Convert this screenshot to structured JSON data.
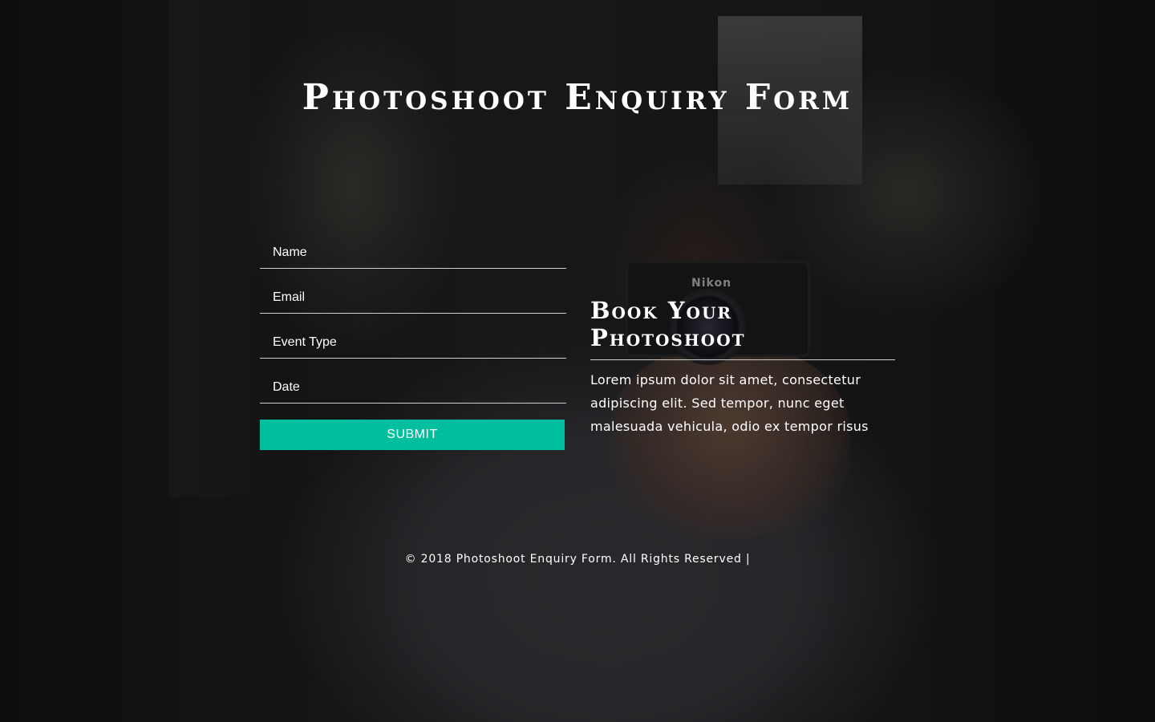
{
  "page": {
    "title": "Photoshoot Enquiry Form"
  },
  "form": {
    "fields": [
      {
        "placeholder": "Name"
      },
      {
        "placeholder": "Email"
      },
      {
        "placeholder": "Event Type"
      },
      {
        "placeholder": "Date"
      }
    ],
    "submit_label": "SUBMIT"
  },
  "info": {
    "heading": "Book Your Photoshoot",
    "text": "Lorem ipsum dolor sit amet, consectetur adipiscing elit. Sed tempor, nunc eget malesuada vehicula, odio ex tempor risus"
  },
  "background": {
    "camera_brand": "Nikon"
  },
  "footer": {
    "text": "© 2018 Photoshoot Enquiry Form. All Rights Reserved |"
  },
  "colors": {
    "accent": "#00bf9f",
    "text": "#ffffff",
    "divider": "#cfcfcf"
  }
}
